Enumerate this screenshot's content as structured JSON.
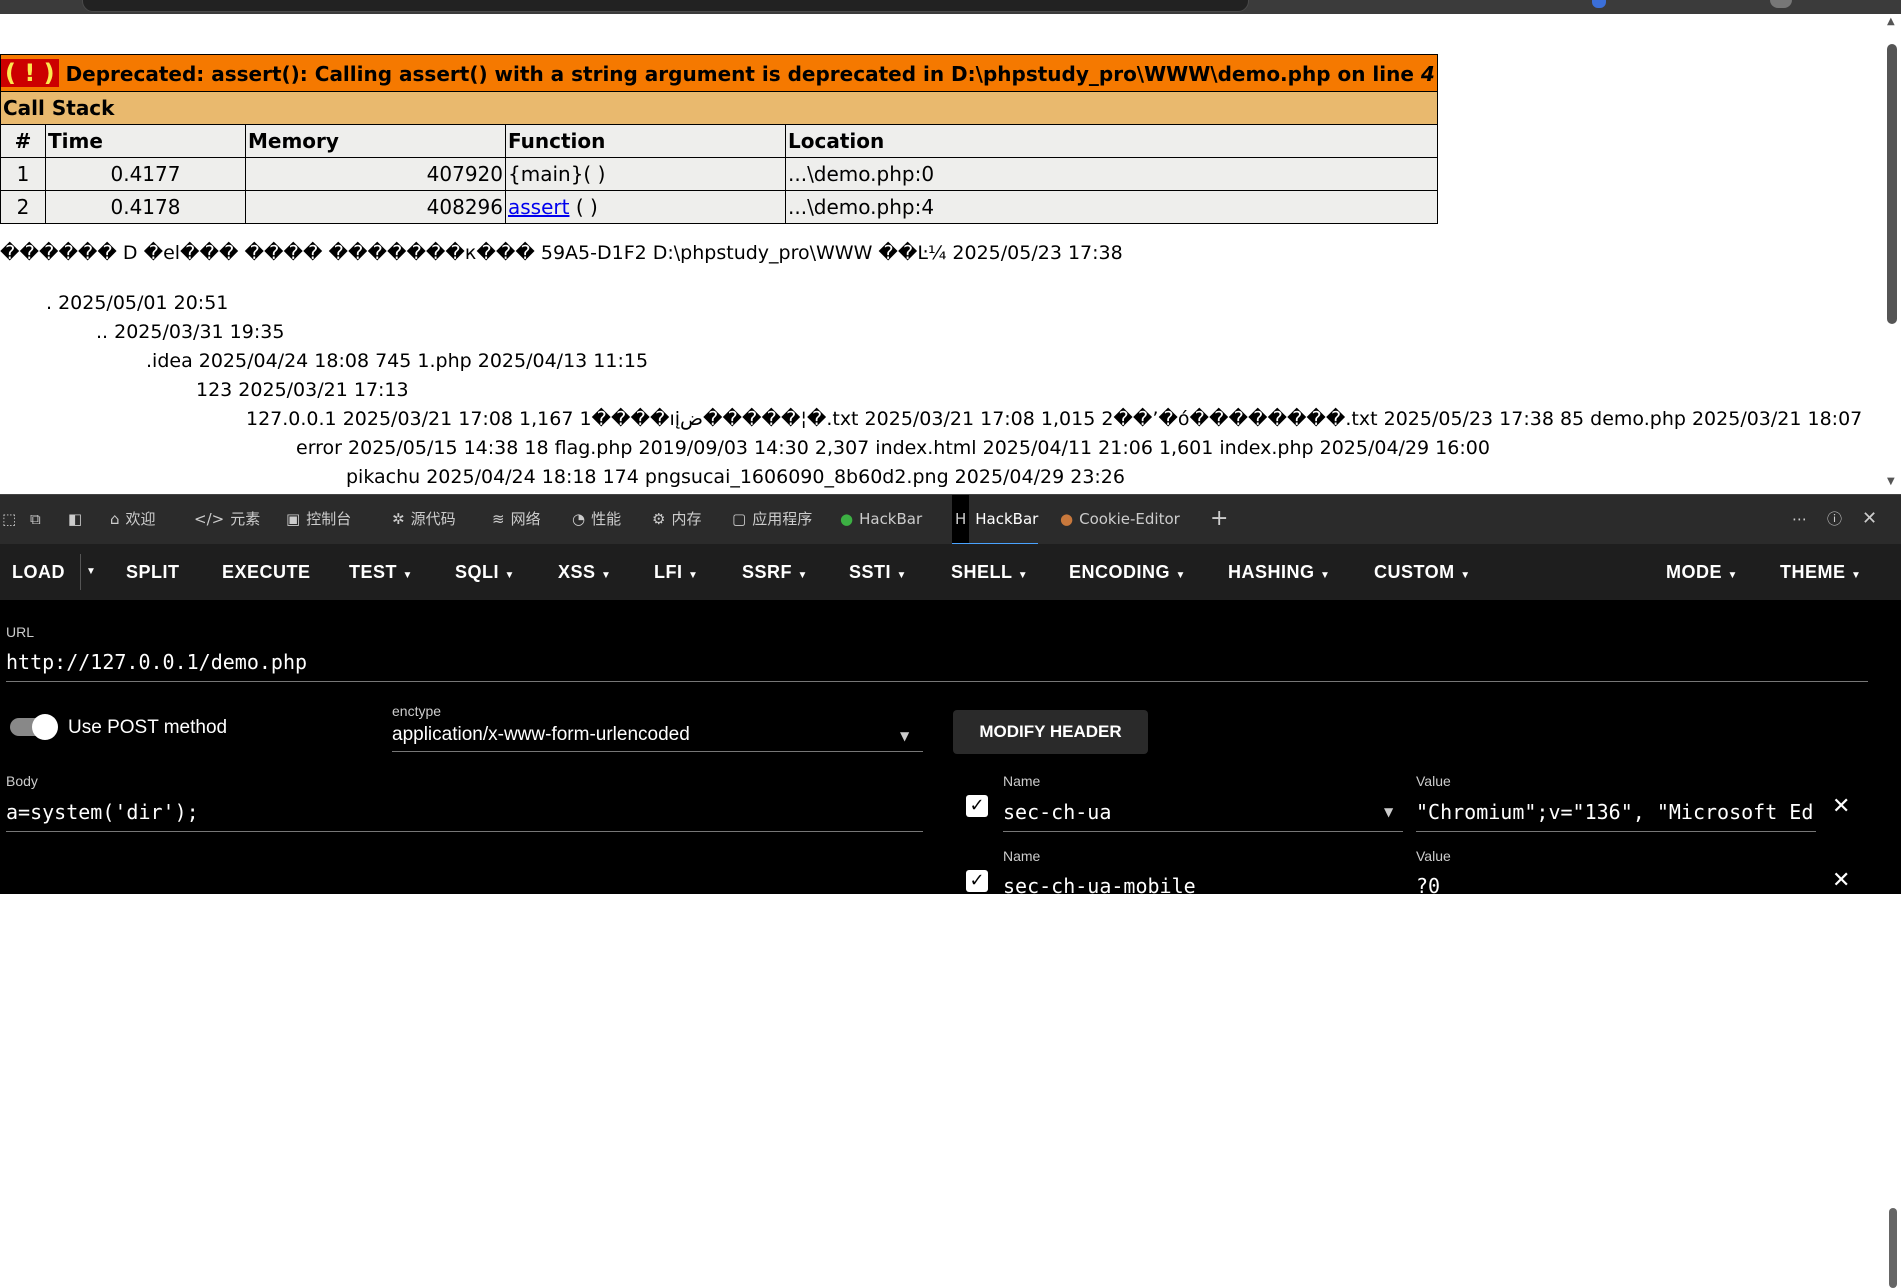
{
  "php_error": {
    "badge": "( ! )",
    "message": "Deprecated: assert(): Calling assert() with a string argument is deprecated in D:\\phpstudy_pro\\WWW\\demo.php on line ",
    "line": "4",
    "call_stack_title": "Call Stack",
    "columns": [
      "#",
      "Time",
      "Memory",
      "Function",
      "Location"
    ],
    "rows": [
      {
        "num": "1",
        "time": "0.4177",
        "memory": "407920",
        "function": "{main}( )",
        "function_link": "",
        "function_suffix": "",
        "location": "...\\demo.php:0"
      },
      {
        "num": "2",
        "time": "0.4178",
        "memory": "408296",
        "function": "",
        "function_link": "assert",
        "function_suffix": " ( )",
        "location": "...\\demo.php:4"
      }
    ]
  },
  "dir_output": [
    "������ D �el��� ���� �������к��� 59A5-D1F2 D:\\phpstudy_pro\\WWW ��Ŀ¼ 2025/05/23 17:38",
    ". 2025/05/01 20:51",
    ".. 2025/03/31 19:35",
    ".idea 2025/04/24 18:08 745 1.php 2025/04/13 11:15",
    "123 2025/03/21 17:13",
    "127.0.0.1 2025/03/21 17:08 1,167 1����ıįض�����¦�.txt 2025/03/21 17:08 1,015 2��’�ó��������.txt 2025/05/23 17:38 85 demo.php 2025/03/21 18:07",
    "error 2025/05/15 14:38 18 flag.php 2019/09/03 14:30 2,307 index.html 2025/04/11 21:06 1,601 index.php 2025/04/29 16:00",
    "pikachu 2025/04/24 18:18 174 pngsucai_1606090_8b60d2.png 2025/04/29 23:26"
  ],
  "devtools_tabs": [
    {
      "label": "欢迎",
      "icon": "home-icon"
    },
    {
      "label": "元素",
      "icon": "code-icon"
    },
    {
      "label": "控制台",
      "icon": "console-icon"
    },
    {
      "label": "源代码",
      "icon": "bug-icon"
    },
    {
      "label": "网络",
      "icon": "wifi-icon"
    },
    {
      "label": "性能",
      "icon": "gauge-icon"
    },
    {
      "label": "内存",
      "icon": "gear-icon"
    },
    {
      "label": "应用程序",
      "icon": "app-icon"
    },
    {
      "label": "HackBar",
      "icon": "hackbar-green-icon"
    },
    {
      "label": "HackBar",
      "icon": "hackbar-dark-icon"
    },
    {
      "label": "Cookie-Editor",
      "icon": "cookie-icon"
    }
  ],
  "hackbar": {
    "menu": [
      "LOAD",
      "SPLIT",
      "EXECUTE",
      "TEST",
      "SQLI",
      "XSS",
      "LFI",
      "SSRF",
      "SSTI",
      "SHELL",
      "ENCODING",
      "HASHING",
      "CUSTOM",
      "MODE",
      "THEME"
    ],
    "url_label": "URL",
    "url_value": "http://127.0.0.1/demo.php",
    "post_label": "Use POST method",
    "enctype_label": "enctype",
    "enctype_value": "application/x-www-form-urlencoded",
    "modify_header": "MODIFY HEADER",
    "body_label": "Body",
    "body_value": "a=system('dir');",
    "headers": [
      {
        "name_label": "Name",
        "name": "sec-ch-ua",
        "value_label": "Value",
        "value": "\"Chromium\";v=\"136\", \"Microsoft Ed"
      },
      {
        "name_label": "Name",
        "name": "sec-ch-ua-mobile",
        "value_label": "Value",
        "value": "?0"
      }
    ]
  }
}
